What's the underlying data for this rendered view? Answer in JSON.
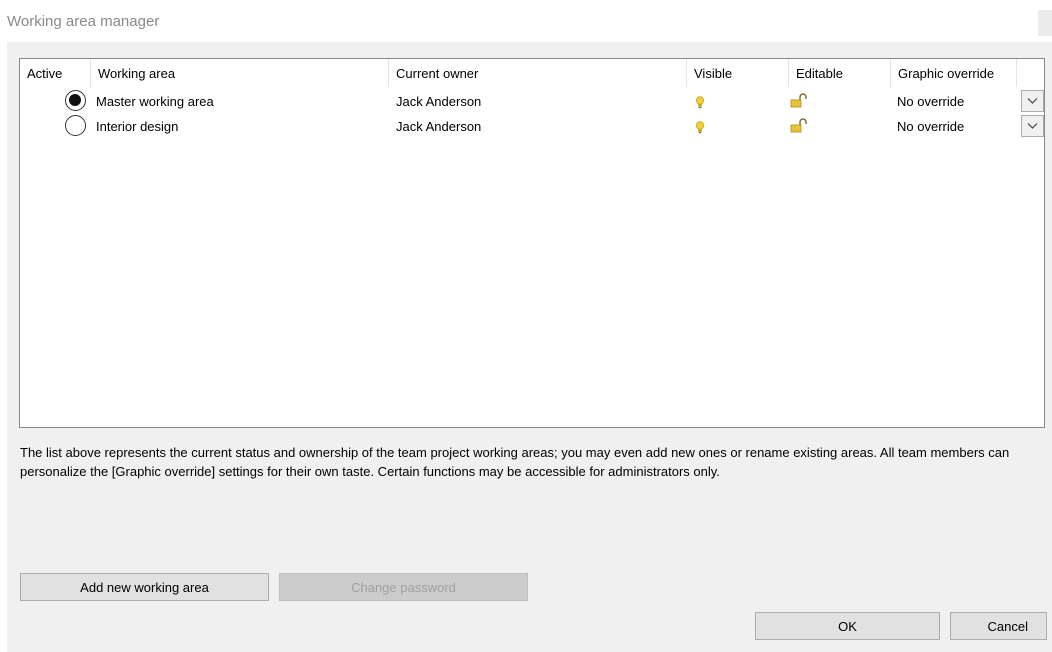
{
  "window": {
    "title": "Working area manager"
  },
  "table": {
    "columns": [
      "Active",
      "Working area",
      "Current owner",
      "Visible",
      "Editable",
      "Graphic override"
    ],
    "rows": [
      {
        "active": true,
        "name": "Master working area",
        "owner": "Jack Anderson",
        "visible_icon": "lightbulb-icon",
        "editable_icon": "unlocked-padlock-icon",
        "override": "No override"
      },
      {
        "active": false,
        "name": "Interior design",
        "owner": "Jack Anderson",
        "visible_icon": "lightbulb-icon",
        "editable_icon": "unlocked-padlock-icon",
        "override": "No override"
      }
    ]
  },
  "description": "The list above represents the current status and ownership of the team project working areas; you may even add new ones or rename existing areas. All team members can personalize the [Graphic override] settings for their own taste. Certain functions may be accessible for administrators only.",
  "buttons": {
    "add_label": "Add new working area",
    "password_label": "Change password",
    "ok_label": "OK",
    "cancel_label": "Cancel"
  },
  "colors": {
    "bulb": "#f2d13a",
    "lock": "#e8c33a",
    "dialog_bg": "#f0f0f0",
    "title_text": "#8a8a8a"
  }
}
